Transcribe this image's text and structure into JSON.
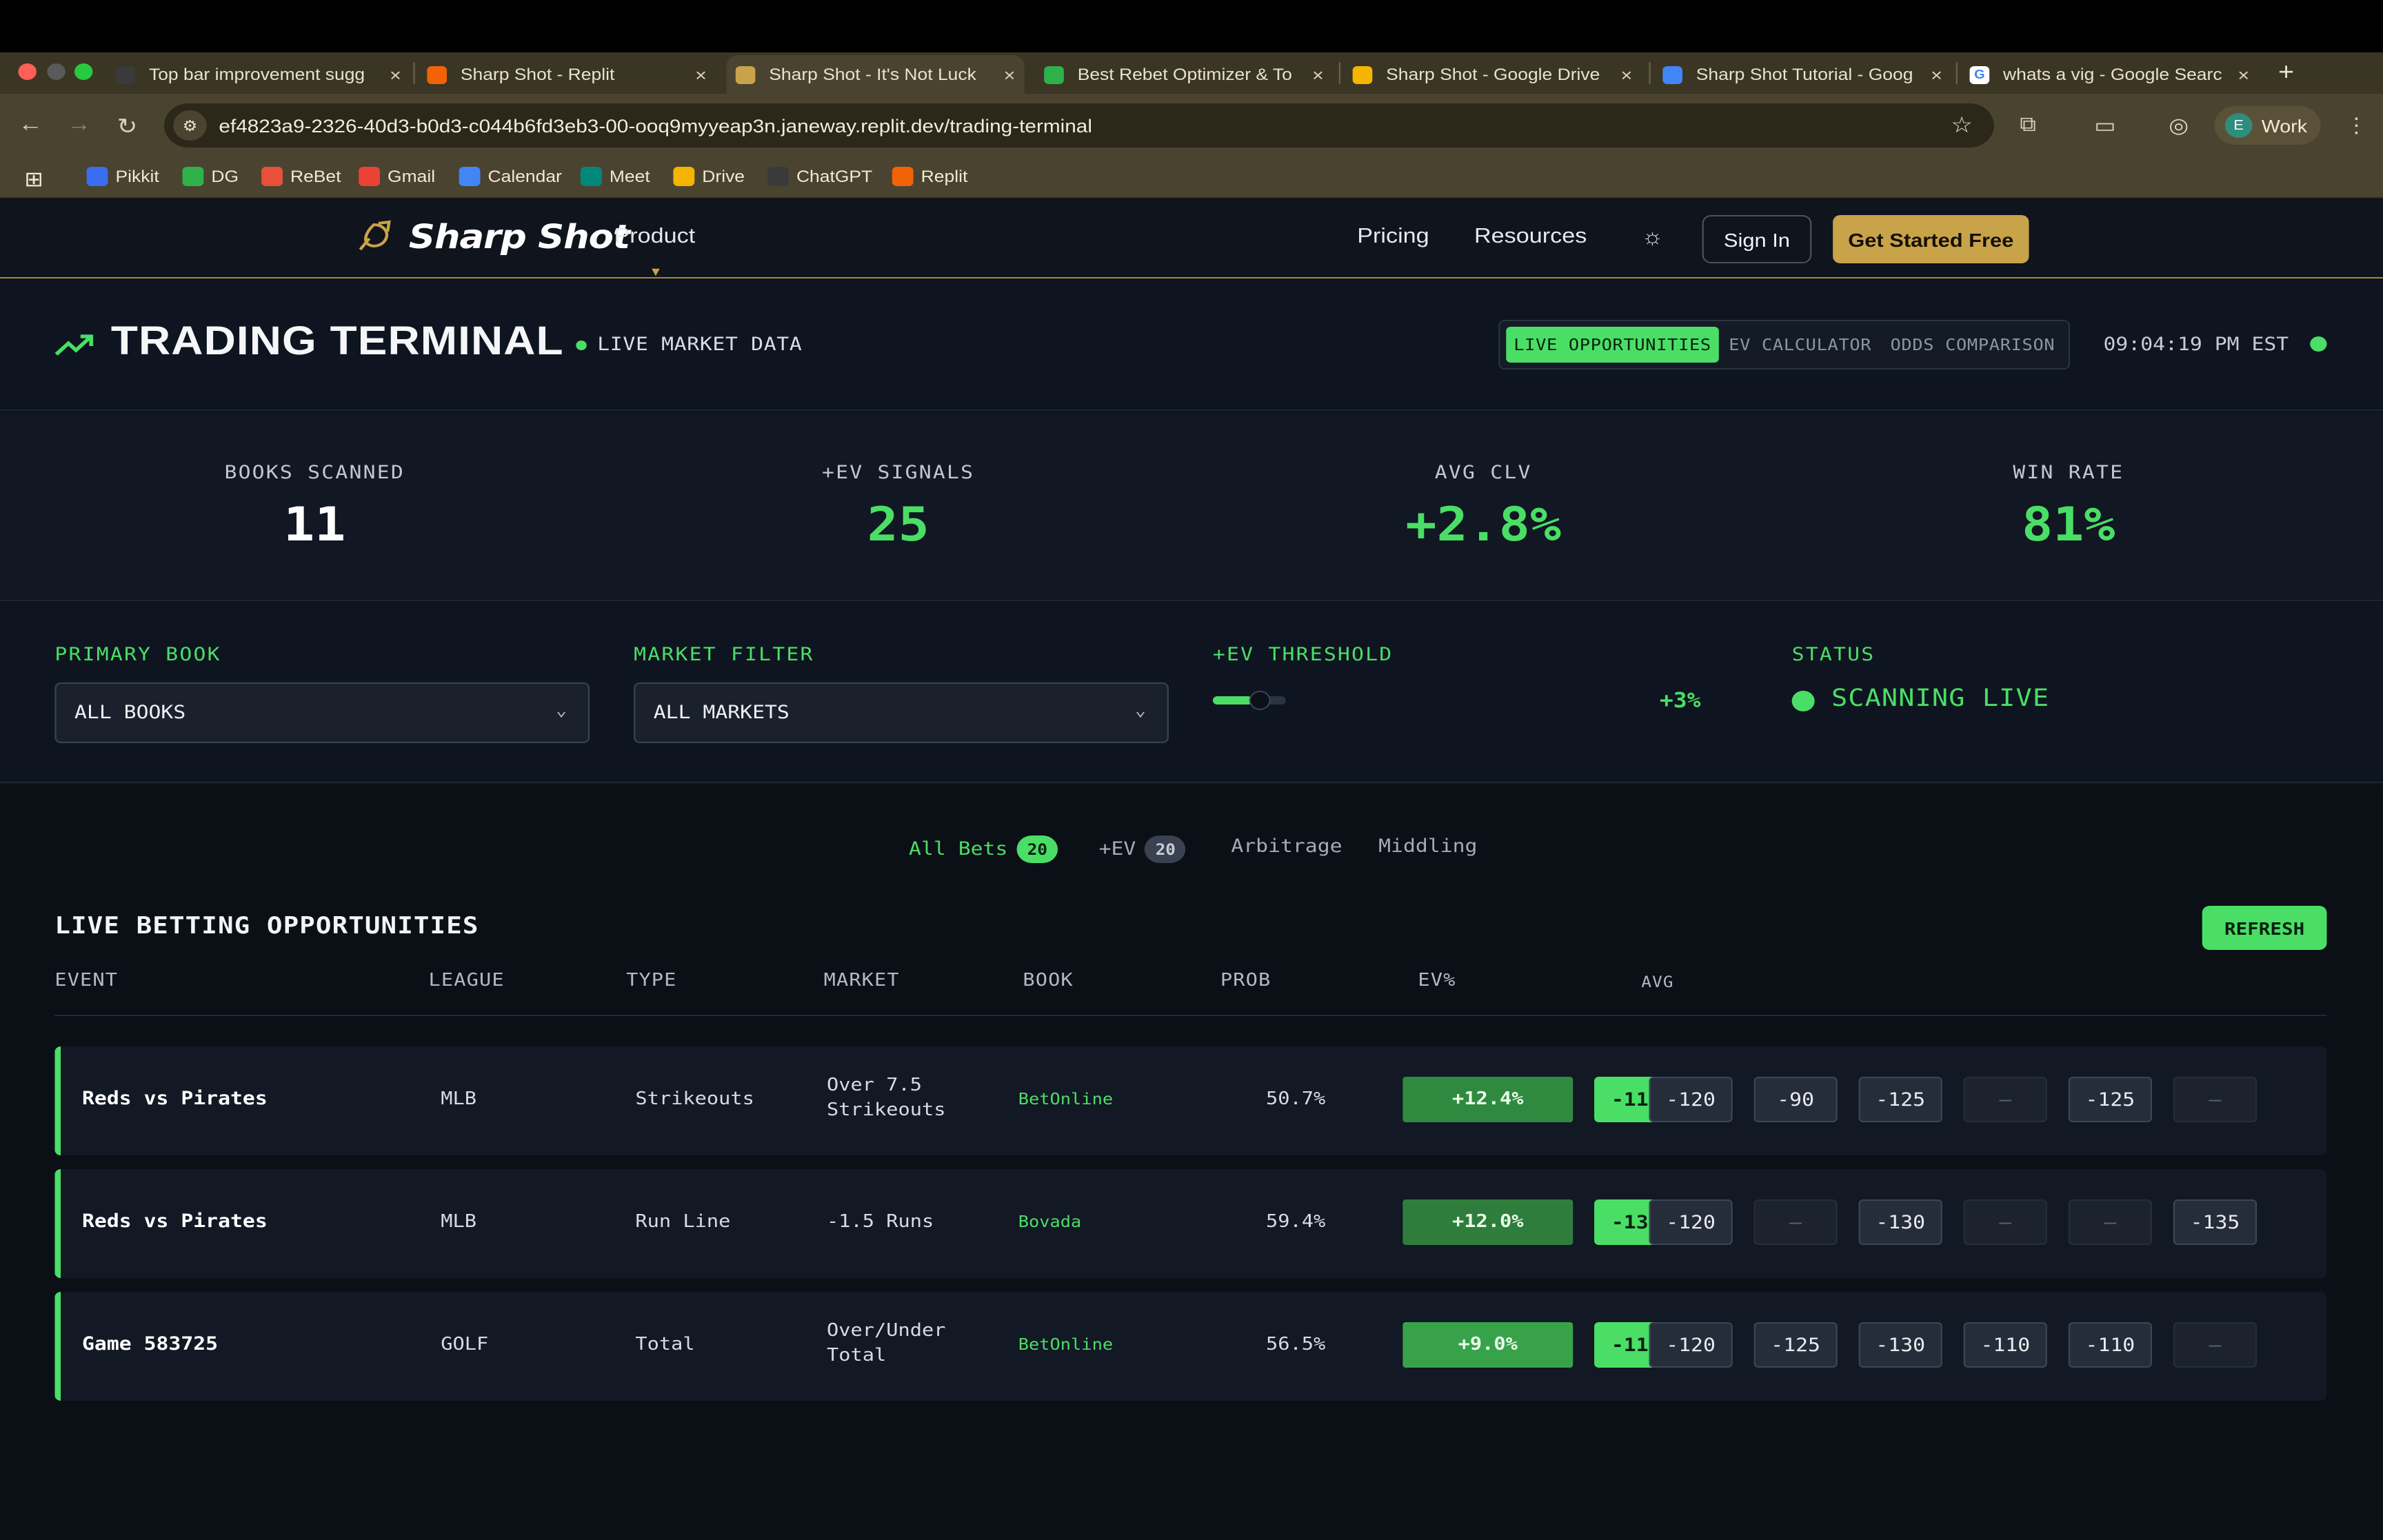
{
  "browser": {
    "tabs": [
      {
        "title": "Top bar improvement sugg",
        "icon": "openai-icon",
        "color": "#3a3a3a"
      },
      {
        "title": "Sharp Shot - Replit",
        "icon": "replit-icon",
        "color": "#f26207"
      },
      {
        "title": "Sharp Shot - It's Not Luck",
        "icon": "sharpshot-icon",
        "color": "#c9a34a"
      },
      {
        "title": "Best Rebet Optimizer & To",
        "icon": "dg-icon",
        "color": "#2fb14a"
      },
      {
        "title": "Sharp Shot - Google Drive",
        "icon": "drive-icon",
        "color": "#f4b400"
      },
      {
        "title": "Sharp Shot Tutorial - Goog",
        "icon": "docs-icon",
        "color": "#4285f4"
      },
      {
        "title": "whats a vig - Google Searc",
        "icon": "google-icon",
        "color": "#ffffff"
      }
    ],
    "url": "ef4823a9-2326-40d3-b0d3-c044b6fd3eb3-00-ooq9myyeap3n.janeway.replit.dev/trading-terminal",
    "profile": {
      "initial": "E",
      "label": "Work"
    },
    "bookmarks": [
      {
        "label": "Pikkit",
        "color": "#3b6df0"
      },
      {
        "label": "DG",
        "color": "#2fb14a"
      },
      {
        "label": "ReBet",
        "color": "#e8503a"
      },
      {
        "label": "Gmail",
        "color": "#ea4335"
      },
      {
        "label": "Calendar",
        "color": "#4285f4"
      },
      {
        "label": "Meet",
        "color": "#00897b"
      },
      {
        "label": "Drive",
        "color": "#f4b400"
      },
      {
        "label": "ChatGPT",
        "color": "#3a3a3a"
      },
      {
        "label": "Replit",
        "color": "#f26207"
      }
    ]
  },
  "site": {
    "logo_text": "Sharp Shot",
    "nav": {
      "product": "Product",
      "pricing": "Pricing",
      "resources": "Resources"
    },
    "sign_in": "Sign In",
    "get_started": "Get Started Free"
  },
  "terminal": {
    "title": "TRADING TERMINAL",
    "live_label": "LIVE MARKET DATA",
    "modes": [
      "LIVE OPPORTUNITIES",
      "EV CALCULATOR",
      "ODDS COMPARISON"
    ],
    "active_mode": "LIVE OPPORTUNITIES",
    "clock": "09:04:19 PM EST"
  },
  "stats": [
    {
      "label": "BOOKS SCANNED",
      "value": "11",
      "color": "#ffffff"
    },
    {
      "label": "+EV SIGNALS",
      "value": "25",
      "color": "#4ade66"
    },
    {
      "label": "AVG CLV",
      "value": "+2.8%",
      "color": "#4ade66"
    },
    {
      "label": "WIN RATE",
      "value": "81%",
      "color": "#4ade66"
    }
  ],
  "filters": {
    "primary_book": {
      "label": "PRIMARY BOOK",
      "value": "ALL BOOKS"
    },
    "market_filter": {
      "label": "MARKET FILTER",
      "value": "ALL MARKETS"
    },
    "ev_threshold": {
      "label": "+EV THRESHOLD",
      "value": "+3%",
      "slider_level": 0.55
    },
    "status": {
      "label": "STATUS",
      "value": "SCANNING LIVE"
    }
  },
  "opportunities": {
    "tabs": [
      {
        "label": "All Bets",
        "count": "20"
      },
      {
        "label": "+EV",
        "count": "20"
      },
      {
        "label": "Arbitrage",
        "count": ""
      },
      {
        "label": "Middling",
        "count": ""
      }
    ],
    "title": "LIVE BETTING OPPORTUNITIES",
    "refresh": "REFRESH",
    "columns": [
      "EVENT",
      "LEAGUE",
      "TYPE",
      "MARKET",
      "BOOK",
      "PROB",
      "EV%",
      "AVG"
    ],
    "rows": [
      {
        "event": "Reds vs Pirates",
        "league": "MLB",
        "type": "Strikeouts",
        "market": [
          "Over 7.5",
          "Strikeouts"
        ],
        "book": "BetOnline",
        "prob": "50.7%",
        "ev": "+12.4%",
        "ev_color": "#2f8a40",
        "avg": "-116",
        "odds": [
          "-120",
          "-90",
          "-125",
          "–",
          "-125",
          "–"
        ]
      },
      {
        "event": "Reds vs Pirates",
        "league": "MLB",
        "type": "Run Line",
        "market": [
          "-1.5 Runs"
        ],
        "book": "Bovada",
        "prob": "59.4%",
        "ev": "+12.0%",
        "ev_color": "#2f7d3c",
        "avg": "-132",
        "odds": [
          "-120",
          "–",
          "-130",
          "–",
          "–",
          "-135"
        ]
      },
      {
        "event": "Game 583725",
        "league": "GOLF",
        "type": "Total",
        "market": [
          "Over/Under",
          "Total"
        ],
        "book": "BetOnline",
        "prob": "56.5%",
        "ev": "+9.0%",
        "ev_color": "#38a24b",
        "avg": "-119",
        "odds": [
          "-120",
          "-125",
          "-130",
          "-110",
          "-110",
          "–"
        ]
      }
    ]
  }
}
